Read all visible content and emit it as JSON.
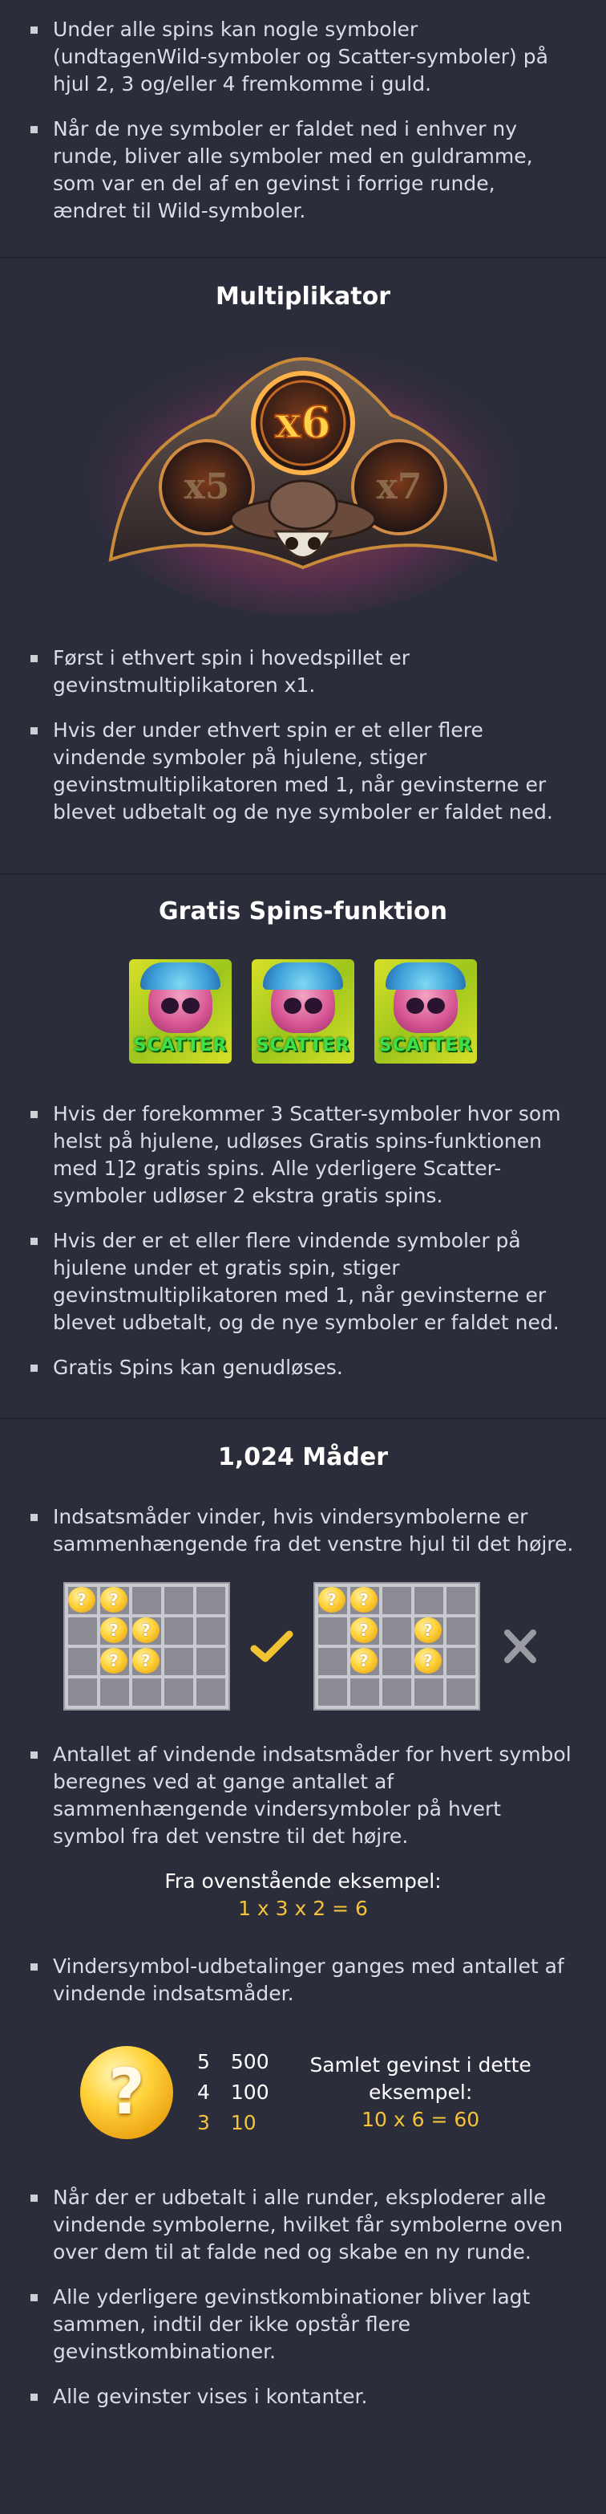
{
  "top_bullets": [
    "Under alle spins kan nogle symboler (undtagenWild-symboler og Scatter-symboler) på hjul 2, 3 og/eller 4 fremkomme i guld.",
    "Når de nye symboler er faldet ned i enhver ny runde, bliver alle symboler med en guldramme, som var en del af en gevinst i forrige runde, ændret til Wild-symboler."
  ],
  "multiplier": {
    "title": "Multiplikator",
    "image_values": [
      "x5",
      "x6",
      "x7"
    ],
    "bullets": [
      "Først i ethvert spin i hovedspillet er gevinstmultiplikatoren x1.",
      "Hvis der under ethvert spin er et eller flere vindende symboler på hjulene, stiger gevinstmultiplikatoren med 1, når gevinsterne er blevet udbetalt og de nye symboler er faldet ned."
    ]
  },
  "free_spins": {
    "title": "Gratis Spins-funktion",
    "scatter_label": "SCATTER",
    "bullets": [
      "Hvis der forekommer 3 Scatter-symboler hvor som helst på hjulene, udløses Gratis spins-funktionen med 1]2 gratis spins. Alle yderligere Scatter-symboler udløser 2 ekstra gratis spins.",
      "Hvis der er et eller flere vindende symboler på hjulene under et gratis spin, stiger gevinstmultiplikatoren med 1, når gevinsterne er blevet udbetalt, og de nye symboler er faldet ned.",
      "Gratis Spins kan genudløses."
    ]
  },
  "ways": {
    "title": "1,024 Måder",
    "bullet_1": "Indsatsmåder vinder, hvis vindersymbolerne er sammenhængende fra det venstre hjul til det højre.",
    "coin_glyph": "?",
    "bullet_2": "Antallet af vindende indsatsmåder for hvert symbol beregnes ved at gange antallet af sammenhængende vindersymboler på hvert symbol fra det venstre til det højre.",
    "example_label": "Fra ovenstående eksempel:",
    "example_calc": "1 x 3 x 2 = 6",
    "bullet_3": "Vindersymbol-udbetalinger ganges med antallet af vindende indsatsmåder.",
    "paytable": [
      {
        "count": "5",
        "value": "500"
      },
      {
        "count": "4",
        "value": "100"
      },
      {
        "count": "3",
        "value": "10"
      }
    ],
    "total_label": "Samlet gevinst i dette eksempel:",
    "total_calc": "10 x 6 = 60",
    "end_bullets": [
      "Når der er udbetalt i alle runder, eksploderer alle vindende symbolerne, hvilket får symbolerne oven over dem til at falde ned og skabe en ny runde.",
      "Alle yderligere gevinstkombinationer bliver lagt sammen, indtil der ikke opstår flere gevinstkombinationer.",
      "Alle gevinster vises i kontanter."
    ]
  },
  "colors": {
    "background": "#2c2d3b",
    "accent_gold": "#f5c33b",
    "check": "#f1c232",
    "cross": "#9a9aa2"
  }
}
